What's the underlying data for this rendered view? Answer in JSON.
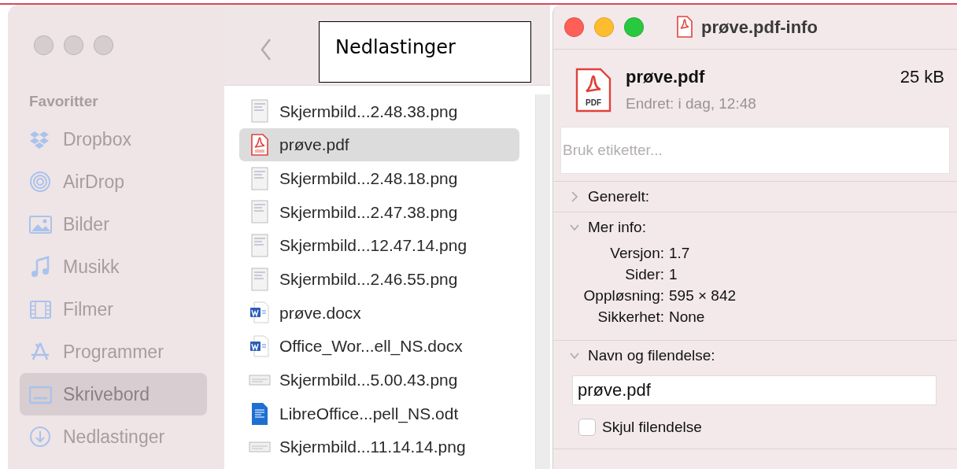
{
  "finder": {
    "sidebar": {
      "heading": "Favoritter",
      "items": [
        {
          "label": "Dropbox",
          "selected": false
        },
        {
          "label": "AirDrop",
          "selected": false
        },
        {
          "label": "Bilder",
          "selected": false
        },
        {
          "label": "Musikk",
          "selected": false
        },
        {
          "label": "Filmer",
          "selected": false
        },
        {
          "label": "Programmer",
          "selected": false
        },
        {
          "label": "Skrivebord",
          "selected": true
        },
        {
          "label": "Nedlastinger",
          "selected": false
        }
      ]
    },
    "files": [
      {
        "name": "Skjermbild...2.48.38.png",
        "kind": "image",
        "selected": false
      },
      {
        "name": "prøve.pdf",
        "kind": "pdf",
        "selected": true
      },
      {
        "name": "Skjermbild...2.48.18.png",
        "kind": "image",
        "selected": false
      },
      {
        "name": "Skjermbild...2.47.38.png",
        "kind": "image",
        "selected": false
      },
      {
        "name": "Skjermbild...12.47.14.png",
        "kind": "image",
        "selected": false
      },
      {
        "name": "Skjermbild...2.46.55.png",
        "kind": "image",
        "selected": false
      },
      {
        "name": "prøve.docx",
        "kind": "word",
        "selected": false
      },
      {
        "name": "Office_Wor...ell_NS.docx",
        "kind": "word",
        "selected": false
      },
      {
        "name": "Skjermbild...5.00.43.png",
        "kind": "wide-image",
        "selected": false
      },
      {
        "name": "LibreOffice...pell_NS.odt",
        "kind": "writer",
        "selected": false
      },
      {
        "name": "Skjermbild...11.14.14.png",
        "kind": "wide-image",
        "selected": false
      }
    ]
  },
  "annotation": {
    "text": "Nedlastinger"
  },
  "info": {
    "title": "prøve.pdf-info",
    "file_name": "prøve.pdf",
    "icon_text": "PDF",
    "size": "25 kB",
    "modified": "Endret: i dag, 12:48",
    "tags": {
      "placeholder": "Bruk etiketter..."
    },
    "sections": [
      {
        "label": "Generelt:",
        "expanded": false
      },
      {
        "label": "Mer info:",
        "expanded": true,
        "rows": [
          {
            "key": "Versjon:",
            "value": "1.7"
          },
          {
            "key": "Sider:",
            "value": "1"
          },
          {
            "key": "Oppløsning:",
            "value": "595 × 842"
          },
          {
            "key": "Sikkerhet:",
            "value": "None"
          }
        ]
      },
      {
        "label": "Navn og filendelse:",
        "expanded": true,
        "name_value": "prøve.pdf",
        "hide_extension": {
          "label": "Skjul filendelse",
          "checked": false
        }
      }
    ]
  }
}
